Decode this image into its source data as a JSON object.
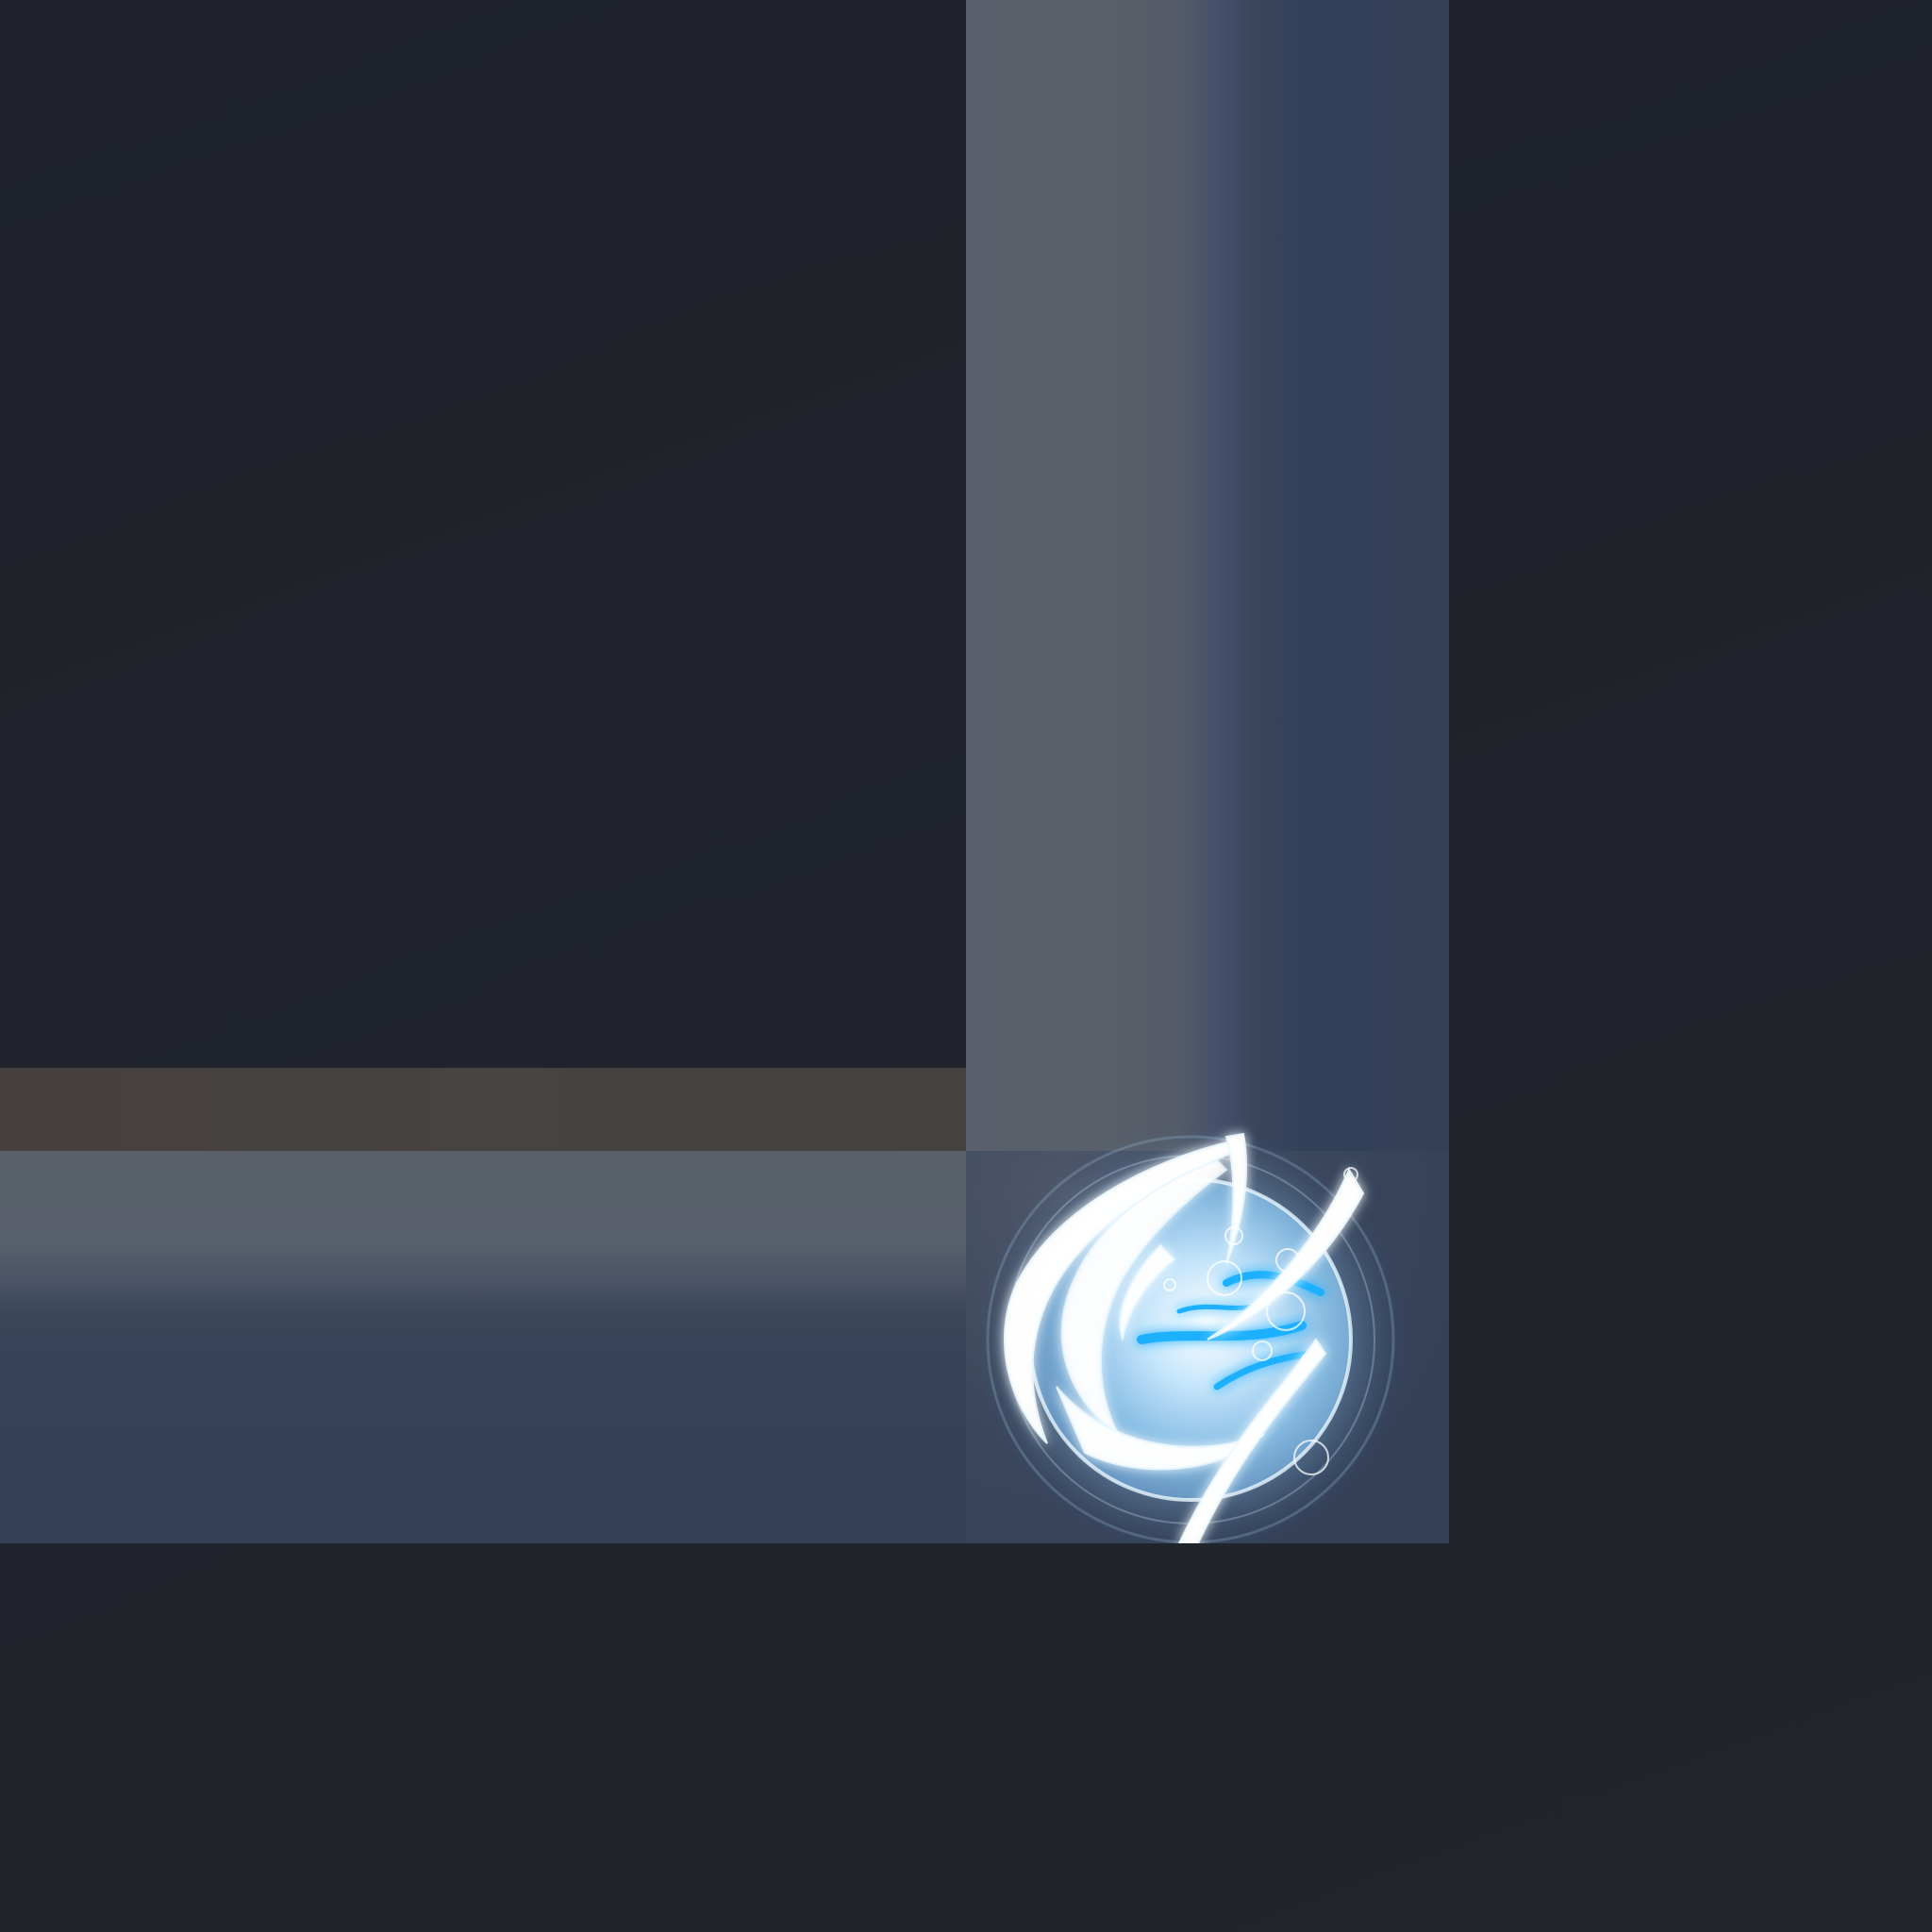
{
  "scene": {
    "description_kind": "game-ui-frame",
    "orb_icon": "water-swirl-orb-icon",
    "colors": {
      "background": "#20232b",
      "dark_panel": "#1f222a",
      "footer_strip": "#464240",
      "frame_gray": "#59606a",
      "frame_blue": "#334057",
      "orb_glow": "#bfe6ff",
      "orb_accent": "#1ab0ff"
    }
  }
}
